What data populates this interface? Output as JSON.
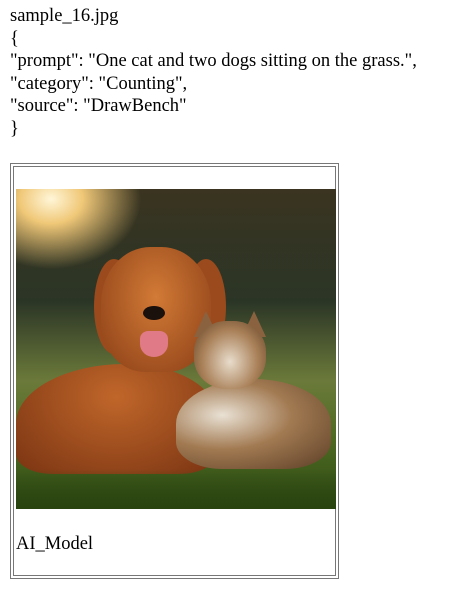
{
  "filename": "sample_16.jpg",
  "json_lines": {
    "open": "{",
    "prompt": "\"prompt\": \"One cat and two dogs sitting on the grass.\",",
    "category": "\"category\": \"Counting\",",
    "source": "\"source\": \"DrawBench\"",
    "close": "}"
  },
  "figure": {
    "image_alt": "golden retriever and tabby cat lying on grass in sunlight",
    "caption": "AI_Model"
  }
}
